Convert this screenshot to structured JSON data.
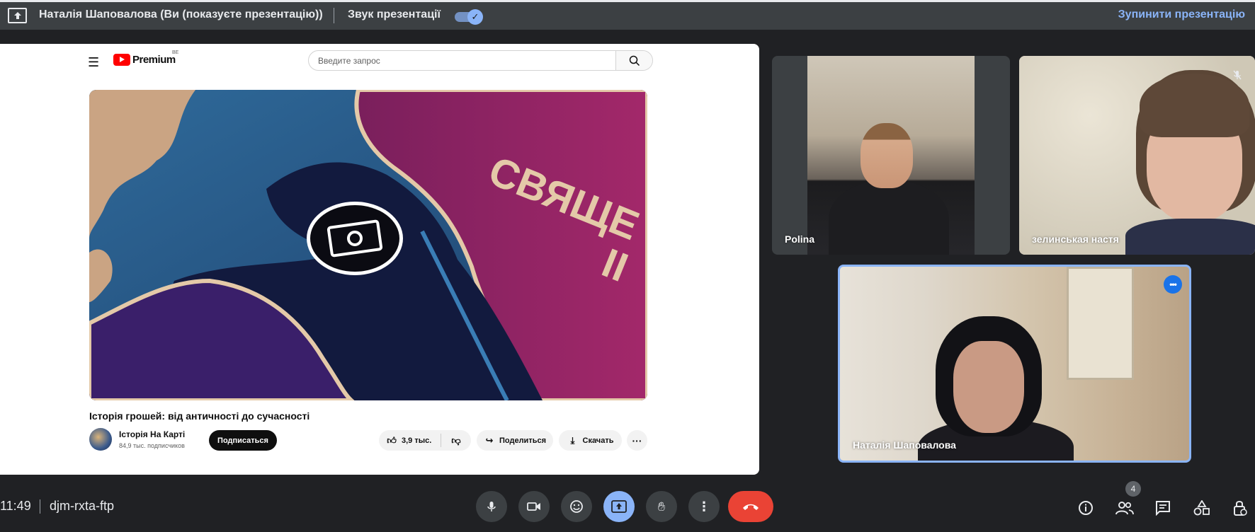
{
  "topbar": {
    "presenter": "Наталія Шаповалова (Ви (показуєте презентацію))",
    "sound_label": "Звук презентації",
    "sound_on": true,
    "stop_label": "Зупинити презентацію"
  },
  "youtube": {
    "brand": "Premium",
    "region": "BE",
    "search_placeholder": "Введите запрос",
    "video_overlay_text": "СВЯЩЕ",
    "video_overlay_text2": "II",
    "title": "Історія грошей: від античності до сучасності",
    "channel": "Історія На Карті",
    "subscribers": "84,9 тыс. подписчиков",
    "subscribe_label": "Подписаться",
    "likes": "3,9 тыс.",
    "share_label": "Поделиться",
    "download_label": "Скачать"
  },
  "participants": [
    {
      "name": "Polina"
    },
    {
      "name": "зелинськая настя",
      "muted": true
    },
    {
      "name": "Наталія Шаповалова",
      "active_speaker": true
    }
  ],
  "bottombar": {
    "time": "11:49",
    "meeting_code": "djm-rxta-ftp",
    "participants_count": "4"
  },
  "colors": {
    "accent": "#8ab4f8",
    "end_call": "#ea4335",
    "background": "#202124",
    "bar": "#3c4043"
  },
  "icons": {
    "present": "present-to-all-icon",
    "mic": "mic-icon",
    "camera": "videocam-icon",
    "emoji": "emoji-icon",
    "present_now": "present-now-icon",
    "hand": "raise-hand-icon",
    "more": "more-vert-icon",
    "end": "call-end-icon",
    "info": "info-icon",
    "people": "people-icon",
    "chat": "chat-icon",
    "activities": "activities-icon",
    "lock": "host-controls-icon"
  }
}
